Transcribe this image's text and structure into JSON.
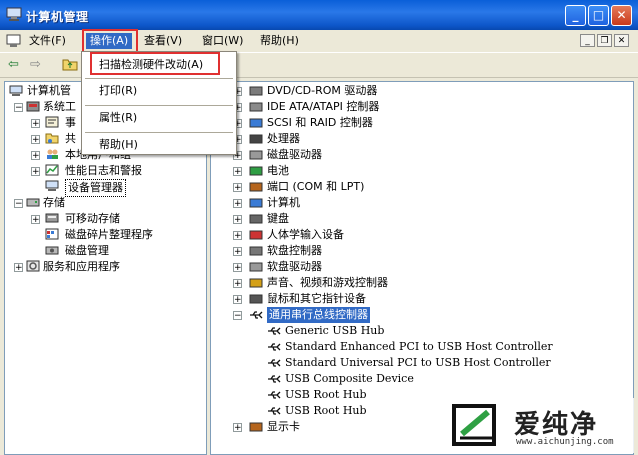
{
  "window": {
    "title": "计算机管理"
  },
  "menu": {
    "file": "文件(F)",
    "action": "操作(A)",
    "view": "查看(V)",
    "window": "窗口(W)",
    "help": "帮助(H)"
  },
  "dropdown": {
    "scan": "扫描检测硬件改动(A)",
    "print": "打印(R)",
    "properties": "属性(R)",
    "help": "帮助(H)"
  },
  "left_tree": [
    {
      "label": "计算机管"
    },
    {
      "label": "系统工"
    },
    {
      "label": "事"
    },
    {
      "label": "共"
    },
    {
      "label": "本地用户和组"
    },
    {
      "label": "性能日志和警报"
    },
    {
      "label": "设备管理器"
    },
    {
      "label": "存储"
    },
    {
      "label": "可移动存储"
    },
    {
      "label": "磁盘碎片整理程序"
    },
    {
      "label": "磁盘管理"
    },
    {
      "label": "服务和应用程序"
    }
  ],
  "right_tree": [
    {
      "label": "DVD/CD-ROM 驱动器"
    },
    {
      "label": "IDE ATA/ATAPI 控制器"
    },
    {
      "label": "SCSI 和 RAID 控制器"
    },
    {
      "label": "处理器"
    },
    {
      "label": "磁盘驱动器"
    },
    {
      "label": "电池"
    },
    {
      "label": "端口 (COM 和 LPT)"
    },
    {
      "label": "计算机"
    },
    {
      "label": "键盘"
    },
    {
      "label": "人体学输入设备"
    },
    {
      "label": "软盘控制器"
    },
    {
      "label": "软盘驱动器"
    },
    {
      "label": "声音、视频和游戏控制器"
    },
    {
      "label": "鼠标和其它指针设备"
    },
    {
      "label": "通用串行总线控制器"
    },
    {
      "label": "Generic USB Hub"
    },
    {
      "label": "Standard Enhanced PCI to USB Host Controller"
    },
    {
      "label": "Standard Universal PCI to USB Host Controller"
    },
    {
      "label": "USB Composite Device"
    },
    {
      "label": "USB Root Hub"
    },
    {
      "label": "USB Root Hub"
    },
    {
      "label": "显示卡"
    }
  ],
  "watermark": {
    "brand": "爱纯净",
    "url": "www.aichunjing.com"
  },
  "colors": {
    "titlebar": "#0a5fd8",
    "selection": "#316ac5",
    "highlight": "#e03030"
  }
}
